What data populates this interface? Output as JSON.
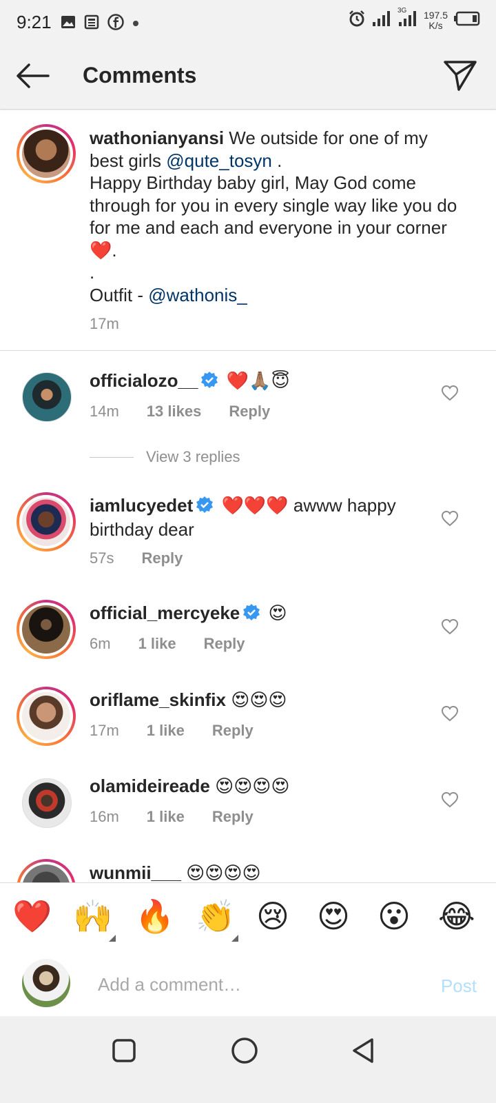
{
  "status_bar": {
    "time": "9:21",
    "network": "3G",
    "speed_value": "197.5",
    "speed_unit": "K/s"
  },
  "header": {
    "title": "Comments"
  },
  "caption": {
    "username": "wathonianyansi",
    "text_part1": " We outside for one of my best girls ",
    "mention1": "@qute_tosyn",
    "text_part2": " .",
    "line2": "Happy Birthday baby girl, May God come through for you in every single way like you do for me and each and everyone in your corner ❤️.",
    "line3": ".",
    "line4_prefix": "Outfit - ",
    "mention2": "@wathonis_",
    "time": "17m"
  },
  "comments": [
    {
      "username": "officialozo__",
      "verified": true,
      "text": " ❤️🙏🏽😇",
      "time": "14m",
      "likes": "13 likes",
      "reply": "Reply"
    },
    {
      "username": "iamlucyedet",
      "verified": true,
      "text": " ❤️❤️❤️ awww happy birthday dear",
      "time": "57s",
      "likes": "",
      "reply": "Reply"
    },
    {
      "username": "official_mercyeke",
      "verified": true,
      "text": " 😍",
      "time": "6m",
      "likes": "1 like",
      "reply": "Reply"
    },
    {
      "username": "oriflame_skinfix",
      "verified": false,
      "text": " 😍😍😍",
      "time": "17m",
      "likes": "1 like",
      "reply": "Reply"
    },
    {
      "username": "olamideireade",
      "verified": false,
      "text": " 😍😍😍😍",
      "time": "16m",
      "likes": "1 like",
      "reply": "Reply"
    },
    {
      "username": "wunmii___",
      "verified": false,
      "text": " 😍😍😍😍",
      "time": "",
      "likes": "",
      "reply": ""
    }
  ],
  "view_replies": "View 3 replies",
  "quick_emojis": [
    "❤️",
    "🙌",
    "🔥",
    "👏",
    "😢",
    "😍",
    "😮",
    "😂"
  ],
  "comment_input": {
    "placeholder": "Add a comment…",
    "post_label": "Post"
  },
  "colors": {
    "mention": "#003569",
    "meta": "#8e8e8e",
    "post_disabled": "#b2dffc",
    "verified": "#3897f0"
  }
}
